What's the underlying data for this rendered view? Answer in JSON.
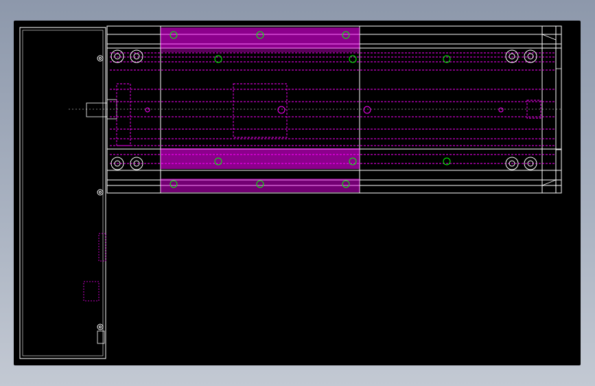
{
  "drawing": {
    "type": "cad-2d-plan-view",
    "subject": "linear-actuator-module",
    "colors": {
      "background": "#000000",
      "frame_outline": "#ffffff",
      "carriage_hatch": "#ff00ff",
      "hidden_lines": "#ff00ff",
      "fasteners": "#00ff00",
      "page_gradient_top": "#8d98ab",
      "page_gradient_bottom": "#c3c9d3"
    }
  }
}
